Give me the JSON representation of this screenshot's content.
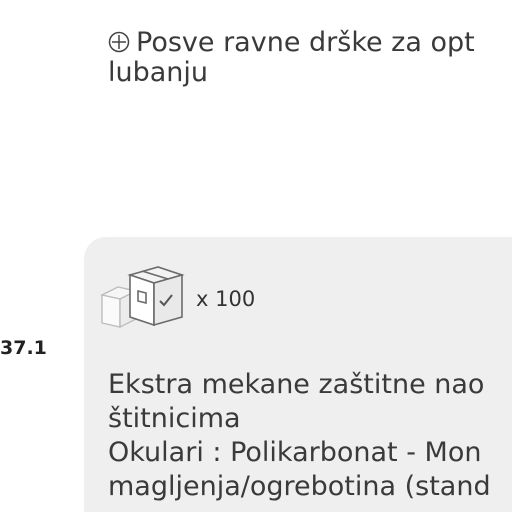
{
  "feature": {
    "line1": "Posve ravne drške za opt",
    "line2": "lubanju",
    "icon": "circle-plus-icon"
  },
  "side_code": "37.1",
  "card": {
    "pack_icon": "boxes-icon",
    "quantity": "x 100",
    "description": [
      "Ekstra mekane zaštitne nao",
      "štitnicima",
      "Okulari : Polikarbonat - Mon",
      "magljenja/ogrebotina (stand"
    ]
  }
}
